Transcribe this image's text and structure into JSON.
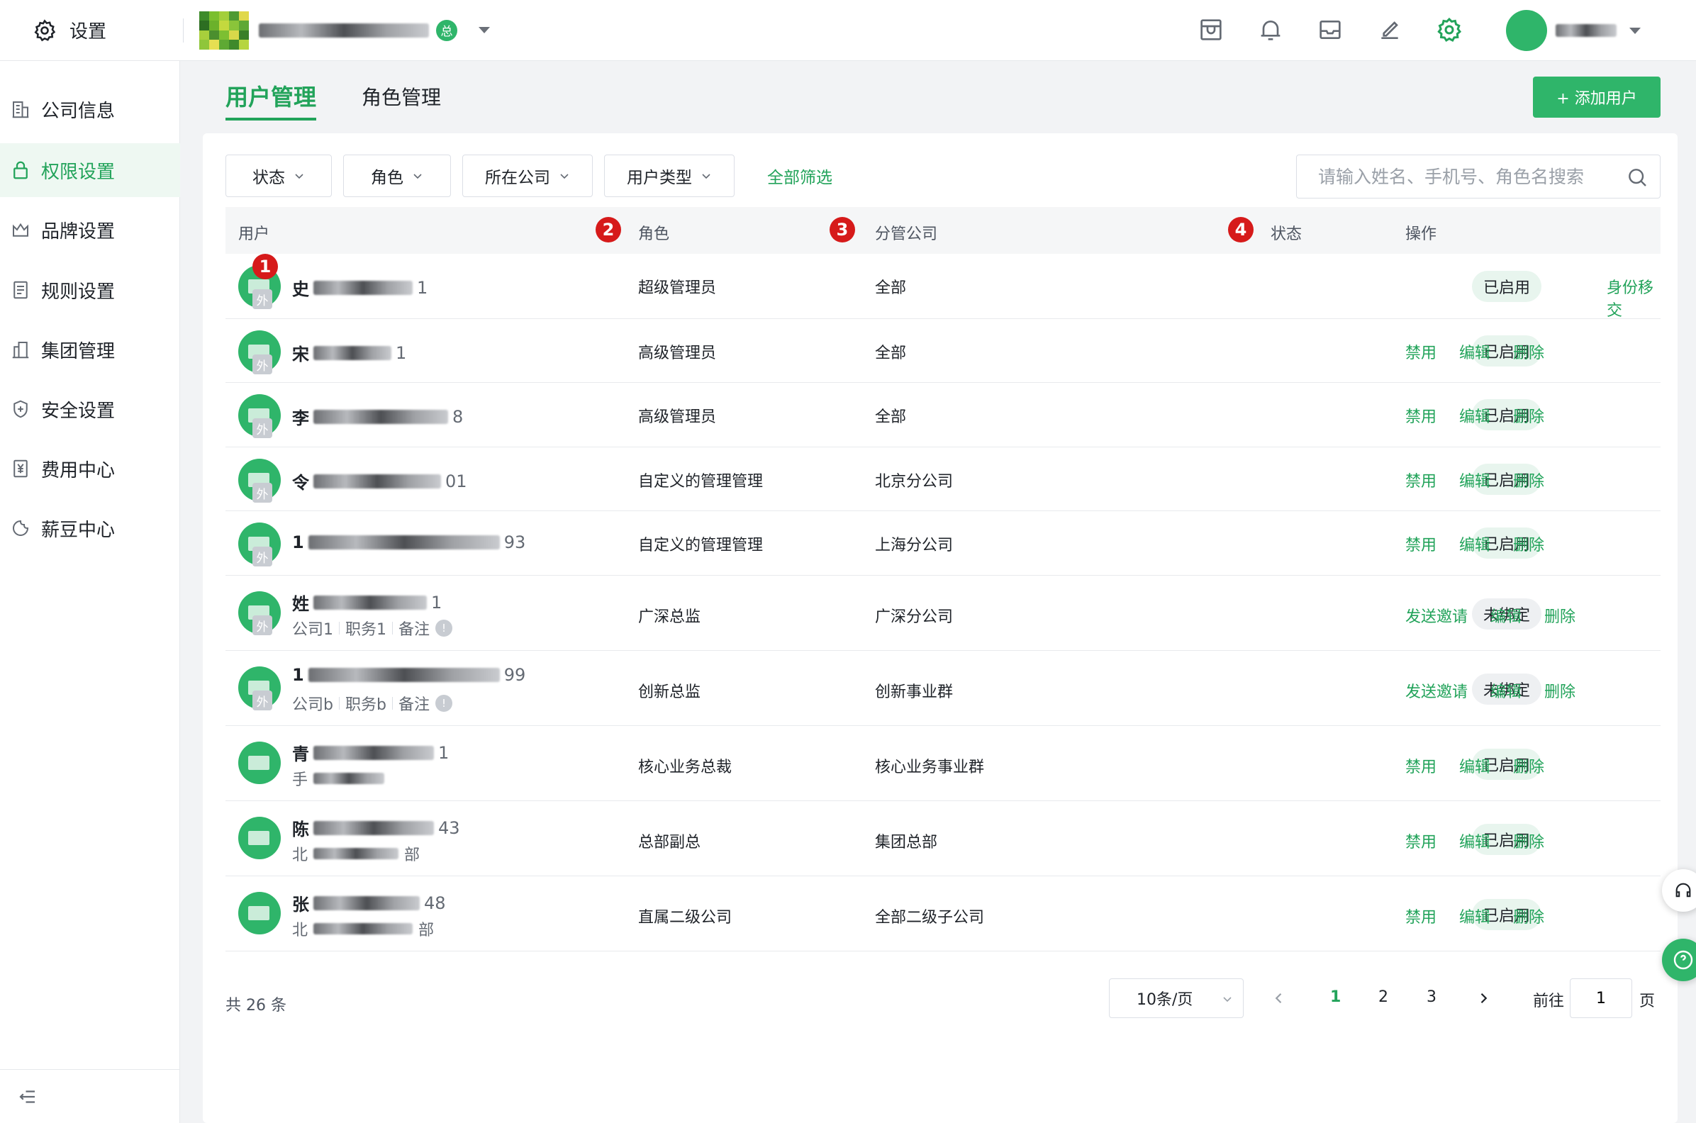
{
  "header": {
    "settings_label": "设置",
    "company_badge": "总"
  },
  "sidebar": {
    "items": [
      {
        "label": "公司信息",
        "icon": "building-icon"
      },
      {
        "label": "权限设置",
        "icon": "lock-icon",
        "active": true
      },
      {
        "label": "品牌设置",
        "icon": "crown-icon"
      },
      {
        "label": "规则设置",
        "icon": "document-icon"
      },
      {
        "label": "集团管理",
        "icon": "group-icon"
      },
      {
        "label": "安全设置",
        "icon": "shield-icon"
      },
      {
        "label": "费用中心",
        "icon": "yen-icon"
      },
      {
        "label": "薪豆中心",
        "icon": "bean-icon"
      }
    ]
  },
  "tabs": [
    {
      "label": "用户管理",
      "active": true
    },
    {
      "label": "角色管理",
      "active": false
    }
  ],
  "add_user_label": "+ 添加用户",
  "filters": [
    "状态",
    "角色",
    "所在公司",
    "用户类型"
  ],
  "filter_all_label": "全部筛选",
  "search": {
    "placeholder": "请输入姓名、手机号、角色名搜索"
  },
  "table": {
    "columns": {
      "user": "用户",
      "role": "角色",
      "company": "分管公司",
      "status": "状态",
      "ops": "操作"
    },
    "markers": [
      "1",
      "2",
      "3",
      "4"
    ],
    "ext_badge": "外",
    "rows": [
      {
        "name": "史",
        "phone_tail": "1",
        "role": "超级管理员",
        "company": "全部",
        "status": "已启用",
        "ops": [
          "身份移交"
        ]
      },
      {
        "name": "宋",
        "phone_tail": "1",
        "role": "高级管理员",
        "company": "全部",
        "status": "已启用",
        "ops": [
          "禁用",
          "编辑",
          "删除"
        ]
      },
      {
        "name": "李",
        "phone_tail": "8",
        "role": "高级管理员",
        "company": "全部",
        "status": "已启用",
        "ops": [
          "禁用",
          "编辑",
          "删除"
        ]
      },
      {
        "name": "令",
        "phone_tail": "01",
        "role": "自定义的管理管理",
        "company": "北京分公司",
        "status": "已启用",
        "ops": [
          "禁用",
          "编辑",
          "删除"
        ]
      },
      {
        "name": "1",
        "phone_tail": "93",
        "role": "自定义的管理管理",
        "company": "上海分公司",
        "status": "已启用",
        "ops": [
          "禁用",
          "编辑",
          "删除"
        ]
      },
      {
        "name": "姓",
        "phone_tail": "1",
        "sub": [
          "公司1",
          "职务1",
          "备注"
        ],
        "role": "广深总监",
        "company": "广深分公司",
        "status": "未绑定",
        "ops": [
          "发送邀请",
          "编辑",
          "删除"
        ]
      },
      {
        "name": "1",
        "phone_tail": "99",
        "sub": [
          "公司b",
          "职务b",
          "备注"
        ],
        "role": "创新总监",
        "company": "创新事业群",
        "status": "未绑定",
        "ops": [
          "发送邀请",
          "编辑",
          "删除"
        ]
      },
      {
        "name": "青",
        "phone_tail": "1",
        "sub_text": "手",
        "role": "核心业务总裁",
        "company": "核心业务事业群",
        "status": "已启用",
        "ops": [
          "禁用",
          "编辑",
          "删除"
        ]
      },
      {
        "name": "陈",
        "phone_tail": "43",
        "sub_text": "北",
        "sub_tail": "部",
        "role": "总部副总",
        "company": "集团总部",
        "status": "已启用",
        "ops": [
          "禁用",
          "编辑",
          "删除"
        ]
      },
      {
        "name": "张",
        "phone_tail": "48",
        "sub_text": "北",
        "sub_tail": "部",
        "role": "直属二级公司",
        "company": "全部二级子公司",
        "status": "已启用",
        "ops": [
          "禁用",
          "编辑",
          "删除"
        ]
      }
    ]
  },
  "pagination": {
    "total": "共 26 条",
    "page_size": "10条/页",
    "pages": [
      "1",
      "2",
      "3"
    ],
    "current": "1",
    "goto_label": "前往",
    "goto_value": "1",
    "page_suffix": "页"
  },
  "colors": {
    "accent": "#22a35a",
    "button": "#2fb56a",
    "marker": "#d61a1a"
  }
}
